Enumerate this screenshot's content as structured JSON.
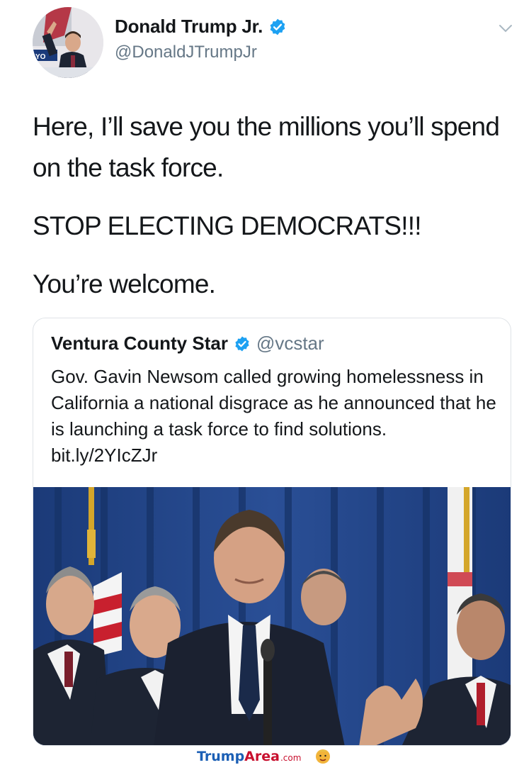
{
  "author": {
    "name": "Donald Trump Jr.",
    "handle": "@DonaldJTrumpJr",
    "avatar_icon": "avatar-photo",
    "verified_icon": "verified-badge-icon"
  },
  "menu_icon": "chevron-down-icon",
  "tweet": {
    "paragraphs": [
      "Here, I’ll save you the millions you’ll spend on the task force.",
      "STOP ELECTING DEMOCRATS!!!",
      "You’re welcome."
    ]
  },
  "quoted": {
    "name": "Ventura County Star",
    "handle": "@vcstar",
    "text": "Gov. Gavin Newsom called growing homelessness in California a national disgrace as he announced that he is launching a task force to find solutions. bit.ly/2YIcZJr",
    "photo_icon": "press-conference-photo"
  },
  "watermark": {
    "part1": "Trump",
    "part2": "Area",
    "part3": ".com",
    "icon": "trump-face-icon"
  },
  "colors": {
    "verified": "#1da1f2",
    "handle": "#657786",
    "text": "#14171a",
    "curtain": "#1f3f7a"
  }
}
